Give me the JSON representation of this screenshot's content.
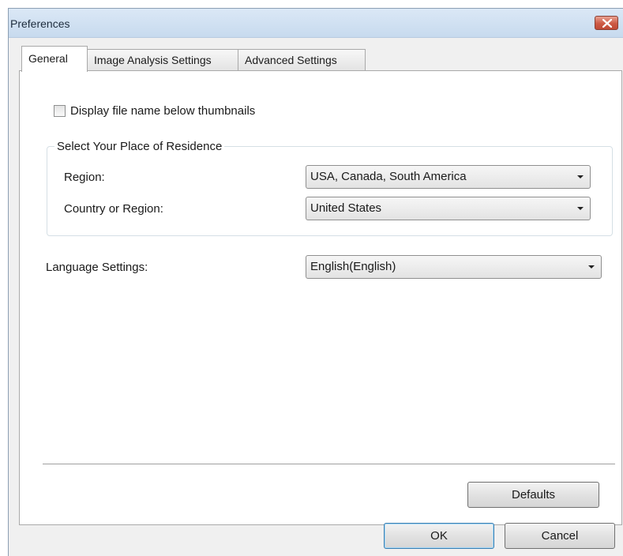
{
  "window": {
    "title": "Preferences"
  },
  "tabs": [
    {
      "label": "General",
      "active": true
    },
    {
      "label": "Image Analysis Settings",
      "active": false
    },
    {
      "label": "Advanced Settings",
      "active": false
    }
  ],
  "general": {
    "display_filename": {
      "label": "Display file name below thumbnails",
      "checked": false
    },
    "residence_group": {
      "legend": "Select Your Place of Residence",
      "region": {
        "label": "Region:",
        "value": "USA, Canada, South America"
      },
      "country": {
        "label": "Country or Region:",
        "value": "United States"
      }
    },
    "language": {
      "label": "Language Settings:",
      "value": "English(English)"
    },
    "defaults_label": "Defaults"
  },
  "footer": {
    "ok_label": "OK",
    "cancel_label": "Cancel"
  },
  "colors": {
    "close_button": "#cd5a44",
    "titlebar": "#dbe8f6",
    "default_button_border": "#3c7fb1"
  }
}
